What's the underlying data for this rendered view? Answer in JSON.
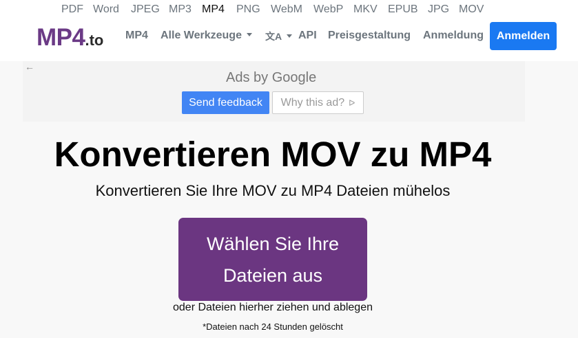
{
  "formats": [
    "PDF",
    "Word",
    "JPEG",
    "MP3",
    "MP4",
    "PNG",
    "WebM",
    "WebP",
    "MKV",
    "EPUB",
    "JPG",
    "MOV"
  ],
  "active_format": "MP4",
  "logo": {
    "main": "MP4",
    "suffix": ".to"
  },
  "nav": {
    "mp4": "MP4",
    "tools": "Alle Werkzeuge",
    "translate_glyph": "文A",
    "api": "API",
    "pricing": "Preisgestaltung",
    "login": "Anmeldung",
    "signup": "Anmelden"
  },
  "ad": {
    "back_arrow": "←",
    "ads_by": "Ads by Google",
    "send_feedback": "Send feedback",
    "why_this_ad": "Why this ad?",
    "why_icon": "ᐅ"
  },
  "hero": {
    "title": "Konvertieren MOV zu MP4",
    "subtitle": "Konvertieren Sie Ihre MOV zu MP4 Dateien mühelos",
    "choose_files": "Wählen Sie Ihre Dateien aus",
    "drop_hint": "oder Dateien hierher ziehen und ablegen",
    "deleted_note": "*Dateien nach 24 Stunden gelöscht"
  },
  "colors": {
    "brand_purple": "#6b3681",
    "signup_blue": "#1a79f2",
    "google_blue": "#4285f4"
  }
}
